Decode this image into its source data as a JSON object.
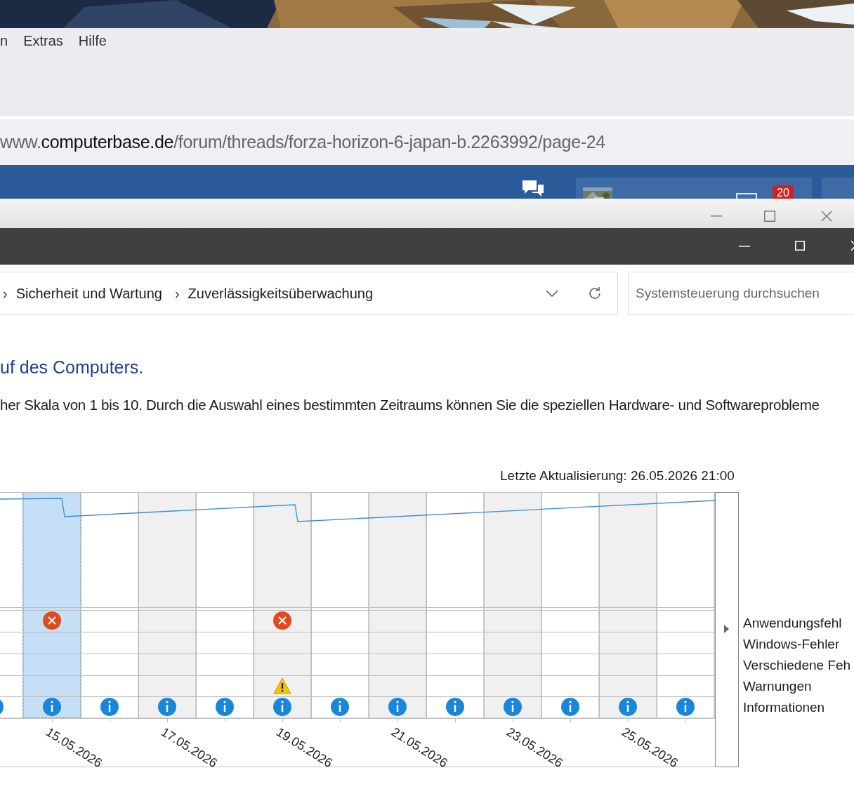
{
  "menu": [
    "n",
    "Extras",
    "Hilfe"
  ],
  "url": {
    "prefix": "www.",
    "domain": "computerbase.de",
    "path": "/forum/threads/forza-horizon-6-japan-b.2263992/page-24"
  },
  "site_nav": {
    "badge": "20"
  },
  "breadcrumb": {
    "separators": [
      "›",
      "›"
    ],
    "items": [
      "Sicherheit und Wartung",
      "Zuverlässigkeitsüberwachung"
    ]
  },
  "search": {
    "placeholder": "Systemsteuerung durchsuchen"
  },
  "heading": "uf des Computers.",
  "description": "her Skala von 1 bis 10. Durch die Auswahl eines bestimmten Zeitraums können Sie die speziellen Hardware- und Softwareprobleme",
  "last_update": "Letzte Aktualisierung: 26.05.2026 21:00",
  "columns": [
    {
      "shaded": false,
      "selected": false,
      "app_error": false,
      "warning": false,
      "info": true
    },
    {
      "date": "15.05.2026",
      "shaded": false,
      "selected": true,
      "app_error": true,
      "warning": false,
      "info": true
    },
    {
      "shaded": false,
      "selected": false,
      "app_error": false,
      "warning": false,
      "info": true
    },
    {
      "date": "17.05.2026",
      "shaded": true,
      "selected": false,
      "app_error": false,
      "warning": false,
      "info": true
    },
    {
      "shaded": false,
      "selected": false,
      "app_error": false,
      "warning": false,
      "info": true
    },
    {
      "date": "19.05.2026",
      "shaded": true,
      "selected": false,
      "app_error": true,
      "warning": true,
      "info": true
    },
    {
      "shaded": false,
      "selected": false,
      "app_error": false,
      "warning": false,
      "info": true
    },
    {
      "date": "21.05.2026",
      "shaded": true,
      "selected": false,
      "app_error": false,
      "warning": false,
      "info": true
    },
    {
      "shaded": false,
      "selected": false,
      "app_error": false,
      "warning": false,
      "info": true
    },
    {
      "date": "23.05.2026",
      "shaded": true,
      "selected": false,
      "app_error": false,
      "warning": false,
      "info": true
    },
    {
      "shaded": false,
      "selected": false,
      "app_error": false,
      "warning": false,
      "info": true
    },
    {
      "date": "25.05.2026",
      "shaded": true,
      "selected": false,
      "app_error": false,
      "warning": false,
      "info": true
    },
    {
      "shaded": false,
      "selected": false,
      "app_error": false,
      "warning": false,
      "info": true
    }
  ],
  "legend": [
    "Anwendungsfehl",
    "Windows-Fehler",
    "Verschiedene Feh",
    "Warnungen",
    "Informationen"
  ]
}
